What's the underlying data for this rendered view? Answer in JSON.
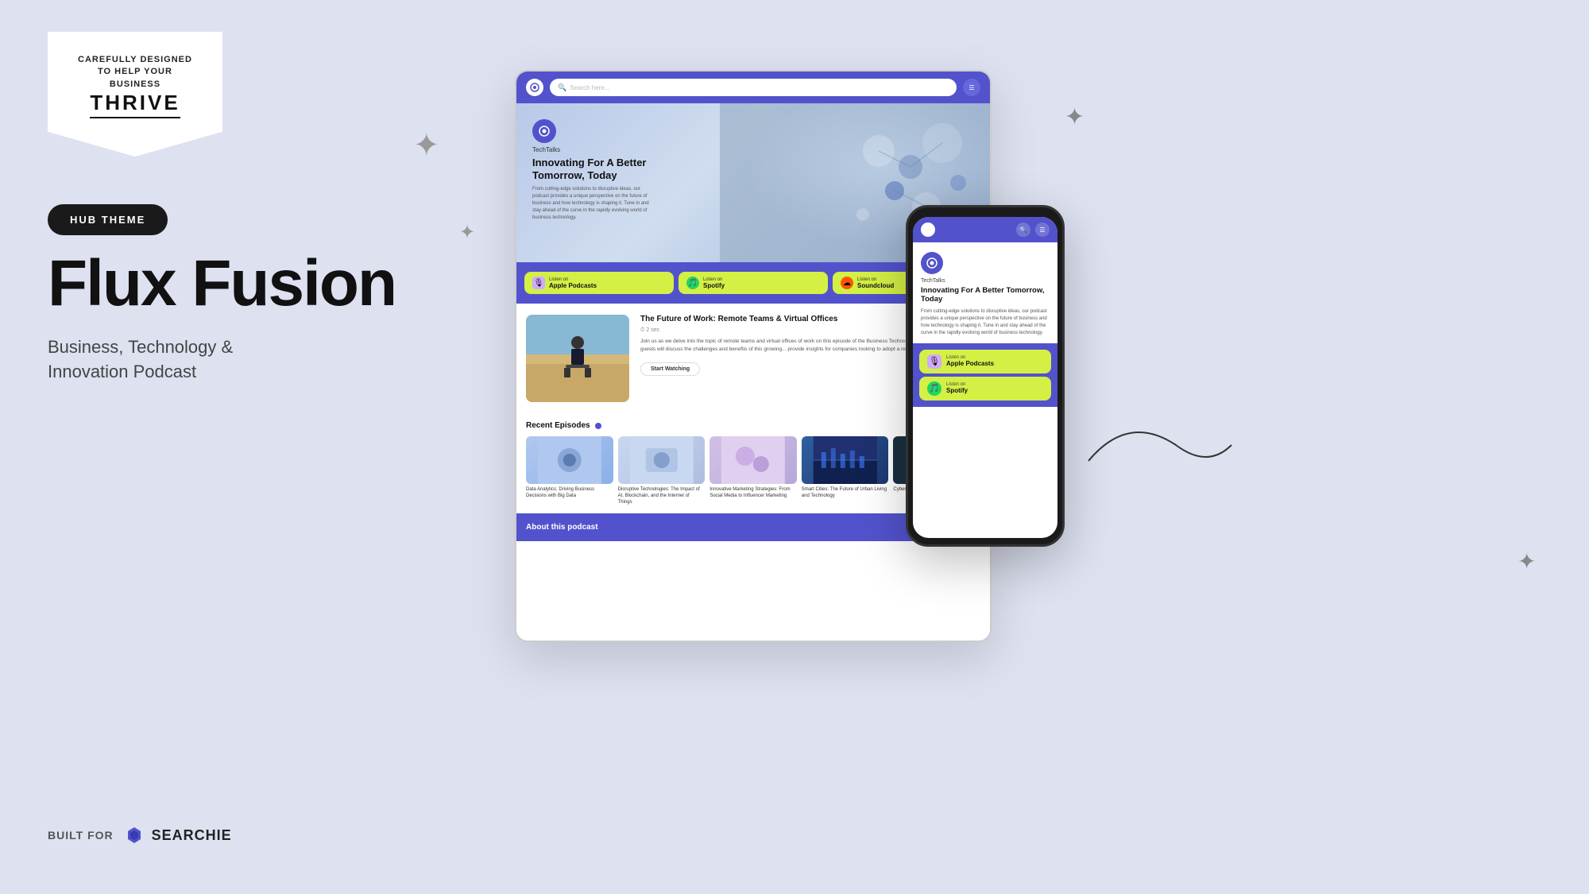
{
  "banner": {
    "line1": "CAREFULLY DESIGNED",
    "line2": "TO HELP YOUR BUSINESS",
    "thrive": "THRIVE"
  },
  "hub_badge": "HUB THEME",
  "main_title": "Flux Fusion",
  "subtitle": "Business, Technology &\nInnovation Podcast",
  "built_for_label": "BUILT FOR",
  "searchie_name": "SEARCHIE",
  "desktop": {
    "search_placeholder": "Search here...",
    "hero": {
      "brand": "TechTalks",
      "title": "Innovating For A Better Tomorrow, Today",
      "description": "From cutting-edge solutions to disruptive ideas, our podcast provides a unique perspective on the future of business and how technology is shaping it. Tune in and stay ahead of the curve in the rapidly evolving world of business technology."
    },
    "listen_buttons": [
      {
        "label": "Listen on",
        "platform": "Apple Podcasts",
        "icon": "🎙"
      },
      {
        "label": "Listen on",
        "platform": "Spotify",
        "icon": "🎵"
      },
      {
        "label": "Listen on",
        "platform": "Soundcloud",
        "icon": "☁"
      }
    ],
    "featured_episode": {
      "title": "The Future of Work: Remote Teams & Virtual Offices",
      "time": "2 sec",
      "description": "Join us as we delve into the topic of remote teams and virtual offices of work on this episode of the Business Technology and Innovation Po... expert guests will discuss the challenges and benefits of this growing... provide insights for companies looking to adopt a remote work strate...",
      "cta": "Start Watching"
    },
    "recent_episodes_title": "Recent Episodes",
    "episodes": [
      {
        "title": "Data Analytics: Driving Business Decisions with Big Data"
      },
      {
        "title": "Disruptive Technologies: The Impact of AI, Blockchain, and the Internet of Things"
      },
      {
        "title": "Innovative Marketing Strategies: From Social Media to Influencer Marketing"
      },
      {
        "title": "Smart Cities: The Future of Urban Living and Technology"
      },
      {
        "title": "Cybersec... Company..."
      }
    ],
    "about_title": "About this podcast"
  },
  "mobile": {
    "brand": "TechTalks",
    "title": "Innovating For A Better Tomorrow, Today",
    "description": "From cutting-edge solutions to disruptive ideas, our podcast provides a unique perspective on the future of business and how technology is shaping it. Tune in and stay ahead of the curve in the rapidly evolving world of business technology.",
    "listen_buttons": [
      {
        "label": "Listen on",
        "platform": "Apple Podcasts",
        "icon": "🎙"
      },
      {
        "label": "Listen on",
        "platform": "Spotify",
        "icon": "🎵"
      }
    ]
  }
}
